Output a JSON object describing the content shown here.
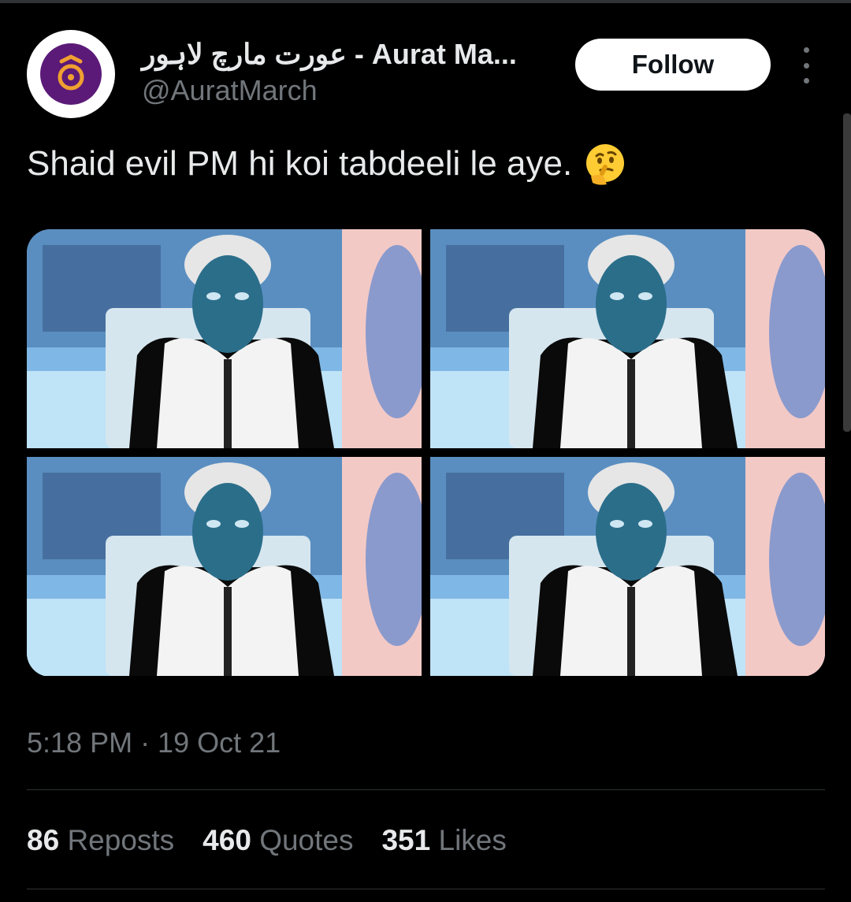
{
  "author": {
    "display_name": "عورت مارچ لاہور - Aurat Ma...",
    "handle": "@AuratMarch",
    "follow_label": "Follow",
    "avatar_mark": "ع"
  },
  "tweet": {
    "text": "Shaid evil PM hi koi tabdeeli le aye.",
    "emoji": "thinking-face",
    "timestamp": "5:18 PM · 19 Oct 21"
  },
  "stats": [
    {
      "value": "86",
      "label": "Reposts"
    },
    {
      "value": "460",
      "label": "Quotes"
    },
    {
      "value": "351",
      "label": "Likes"
    }
  ],
  "colors": {
    "background": "#000000",
    "text": "#e7e9ea",
    "secondary": "#71767b",
    "avatar_accent": "#5b1a78"
  }
}
